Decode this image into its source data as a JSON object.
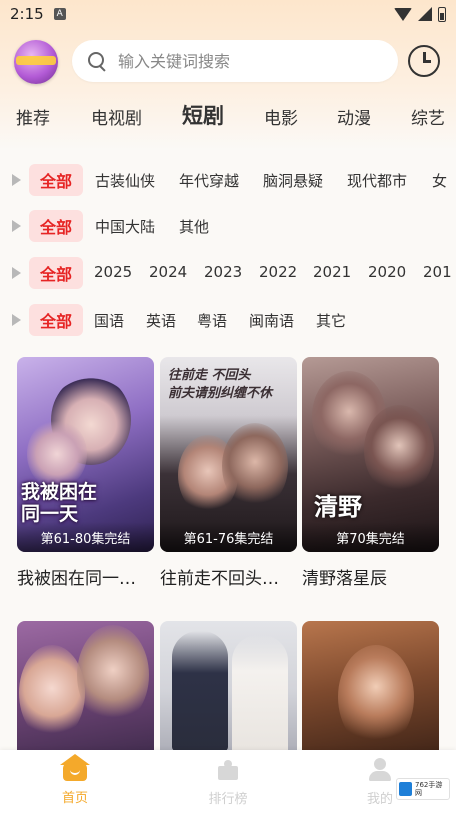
{
  "status_bar": {
    "time": "2:15",
    "app_indicator": "A"
  },
  "header": {
    "logo_icon": "app-logo-icon",
    "search": {
      "placeholder": "输入关键词搜索",
      "value": ""
    },
    "history_icon": "clock-icon"
  },
  "tabs": [
    {
      "label": "推荐",
      "active": false
    },
    {
      "label": "电视剧",
      "active": false
    },
    {
      "label": "短剧",
      "active": true
    },
    {
      "label": "电影",
      "active": false
    },
    {
      "label": "动漫",
      "active": false
    },
    {
      "label": "综艺",
      "active": false
    }
  ],
  "filters": [
    {
      "all": "全部",
      "options": [
        "古装仙侠",
        "年代穿越",
        "脑洞悬疑",
        "现代都市",
        "女"
      ]
    },
    {
      "all": "全部",
      "options": [
        "中国大陆",
        "其他"
      ]
    },
    {
      "all": "全部",
      "options": [
        "2025",
        "2024",
        "2023",
        "2022",
        "2021",
        "2020",
        "201"
      ]
    },
    {
      "all": "全部",
      "options": [
        "国语",
        "英语",
        "粤语",
        "闽南语",
        "其它"
      ]
    }
  ],
  "cards": [
    {
      "title": "我被困在同一…",
      "badge": "第61-80集完结",
      "poster_text": "我被困在\n同一天"
    },
    {
      "title": "往前走不回头…",
      "badge": "第61-76集完结",
      "poster_text": "往前走 不回头\n前夫请别纠缠不休"
    },
    {
      "title": "清野落星辰",
      "badge": "第70集完结",
      "poster_text": "清野"
    },
    {
      "title": "",
      "badge": "",
      "poster_text": ""
    },
    {
      "title": "",
      "badge": "",
      "poster_text": ""
    },
    {
      "title": "",
      "badge": "",
      "poster_text": ""
    }
  ],
  "bottom_nav": [
    {
      "label": "首页",
      "icon": "home-icon",
      "active": true
    },
    {
      "label": "排行榜",
      "icon": "ranking-icon",
      "active": false
    },
    {
      "label": "我的",
      "icon": "profile-icon",
      "active": false
    }
  ],
  "watermark": {
    "text": "762手游网"
  },
  "colors": {
    "accent_red": "#e62424",
    "chip_bg": "#fde0df",
    "tab_underline": "#ffd84a",
    "nav_active": "#f4a92b",
    "nav_inactive": "#cfcfcf"
  }
}
